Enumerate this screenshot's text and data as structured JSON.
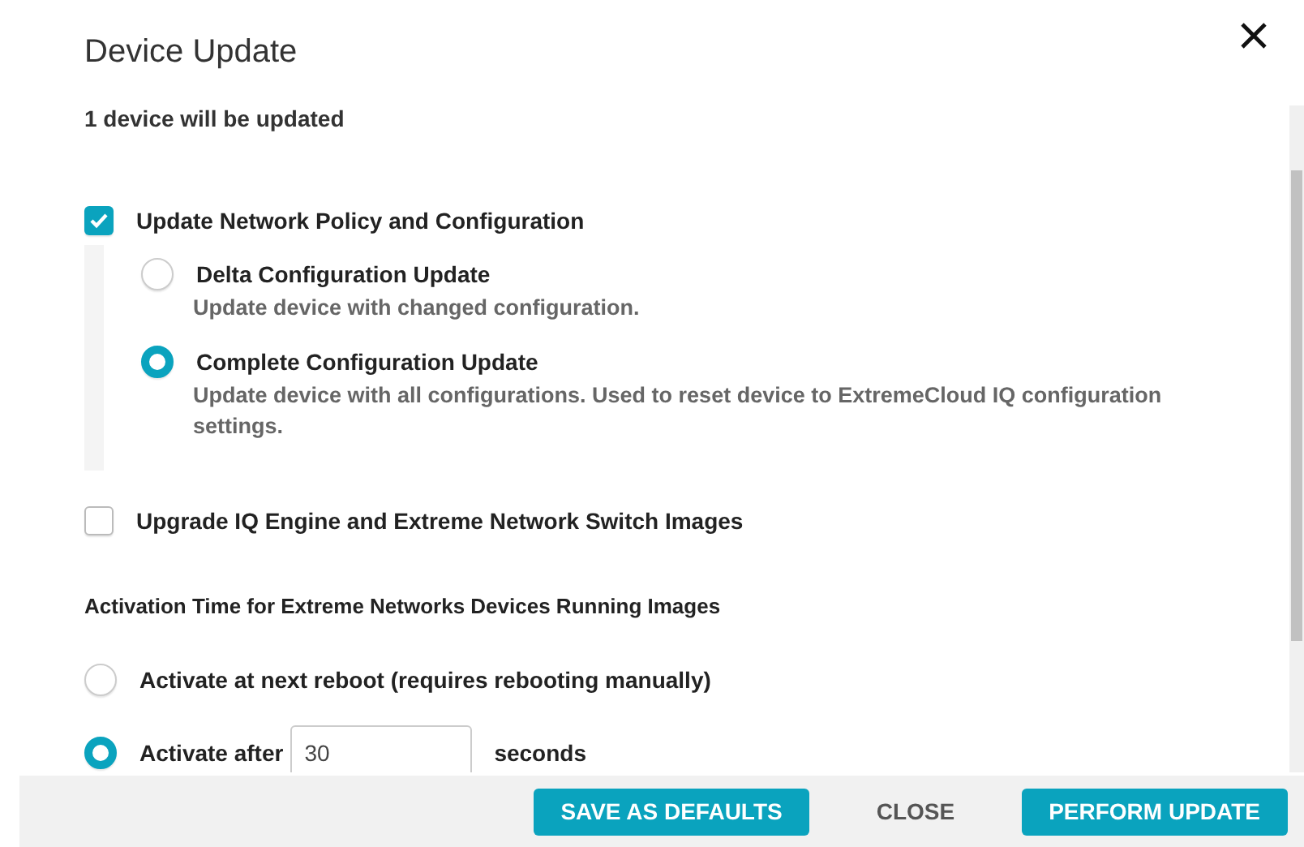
{
  "dialog": {
    "title": "Device Update",
    "summary": "1 device will be updated",
    "options": [
      {
        "kind": "checkbox",
        "label": "Update Network Policy and Configuration",
        "checked": true,
        "choices": [
          {
            "label": "Delta Configuration Update",
            "description": "Update device with changed configuration.",
            "selected": false
          },
          {
            "label": "Complete Configuration Update",
            "description": "Update device with all configurations. Used to reset device to ExtremeCloud IQ configuration settings.",
            "selected": true
          }
        ]
      },
      {
        "kind": "checkbox",
        "label": "Upgrade IQ Engine and Extreme Network Switch Images",
        "checked": false
      }
    ],
    "activation": {
      "heading": "Activation Time for Extreme Networks Devices Running Images",
      "choices": [
        {
          "kind": "plain",
          "label": "Activate at next reboot (requires rebooting manually)",
          "selected": false
        },
        {
          "kind": "timed",
          "label": "Activate after",
          "value": "30",
          "unit": "seconds",
          "selected": true
        }
      ]
    },
    "buttons": [
      {
        "kind": "primary",
        "label": "SAVE AS DEFAULTS"
      },
      {
        "kind": "text",
        "label": "CLOSE"
      },
      {
        "kind": "primary",
        "label": "PERFORM UPDATE"
      }
    ]
  }
}
